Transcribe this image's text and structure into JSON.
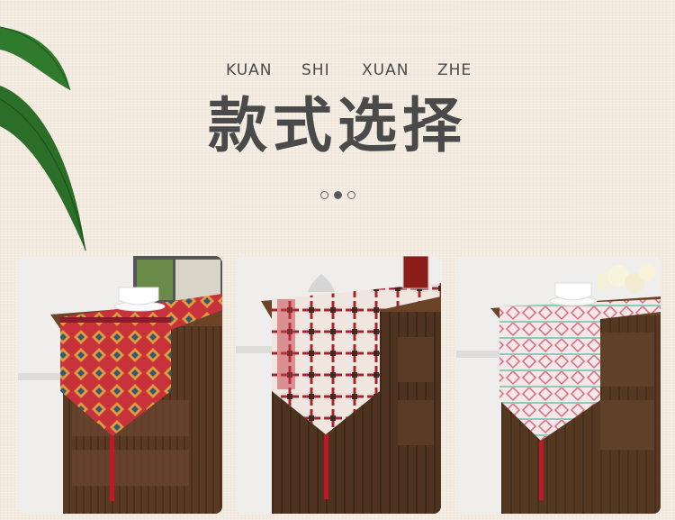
{
  "header": {
    "pinyin": [
      "KUAN",
      "SHI",
      "XUAN",
      "ZHE"
    ],
    "title": "款式选择",
    "pagination": {
      "count": 3,
      "active": 1
    }
  },
  "products": [
    {
      "name": "red-aztec-table-runner",
      "icon": "table-runner-image"
    },
    {
      "name": "cross-pattern-table-runner",
      "icon": "table-runner-image"
    },
    {
      "name": "pink-geometric-table-runner",
      "icon": "table-runner-image"
    }
  ],
  "colors": {
    "background": "#f3ebe0",
    "text": "#4a4a4a",
    "wood": "#5a3a22",
    "tassel": "#c0182a"
  }
}
